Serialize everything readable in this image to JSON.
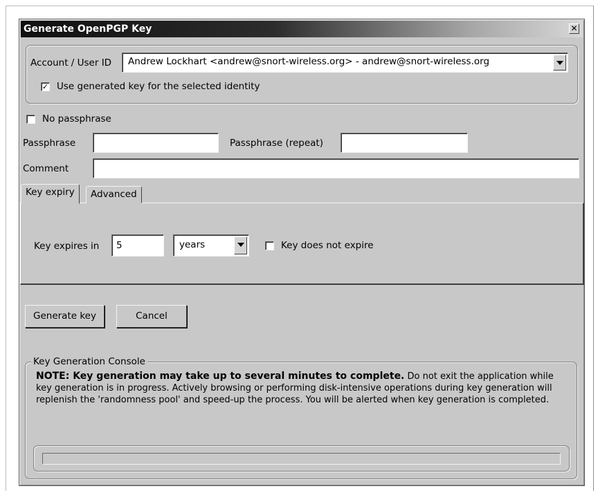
{
  "window": {
    "title": "Generate OpenPGP Key",
    "close_glyph": "✕"
  },
  "account": {
    "label": "Account / User ID",
    "selected": "Andrew Lockhart <andrew@snort-wireless.org> - andrew@snort-wireless.org",
    "use_generated_label": "Use generated key for the selected identity",
    "use_generated_checked": true
  },
  "passphrase": {
    "no_passphrase_label": "No passphrase",
    "no_passphrase_checked": false,
    "passphrase_label": "Passphrase",
    "passphrase_value": "",
    "repeat_label": "Passphrase (repeat)",
    "repeat_value": "",
    "comment_label": "Comment",
    "comment_value": ""
  },
  "tabs": [
    {
      "label": "Key expiry",
      "active": true
    },
    {
      "label": "Advanced",
      "active": false
    }
  ],
  "expiry": {
    "label": "Key expires in",
    "value": "5",
    "unit": "years",
    "no_expire_label": "Key does not expire",
    "no_expire_checked": false
  },
  "buttons": {
    "generate": "Generate key",
    "cancel": "Cancel"
  },
  "console": {
    "legend": "Key Generation Console",
    "note_bold": "NOTE: Key generation may take up to several minutes to complete.",
    "note_text": " Do not exit the application while key generation is in progress. Actively browsing or performing disk-intensive operations during key generation will replenish the 'randomness pool' and speed-up the process. You will be alerted when key generation is completed.",
    "progress": 0
  },
  "icons": {
    "checkbox_checked": "checkmark-icon",
    "dropdown": "chevron-down-icon",
    "close": "close-icon"
  }
}
